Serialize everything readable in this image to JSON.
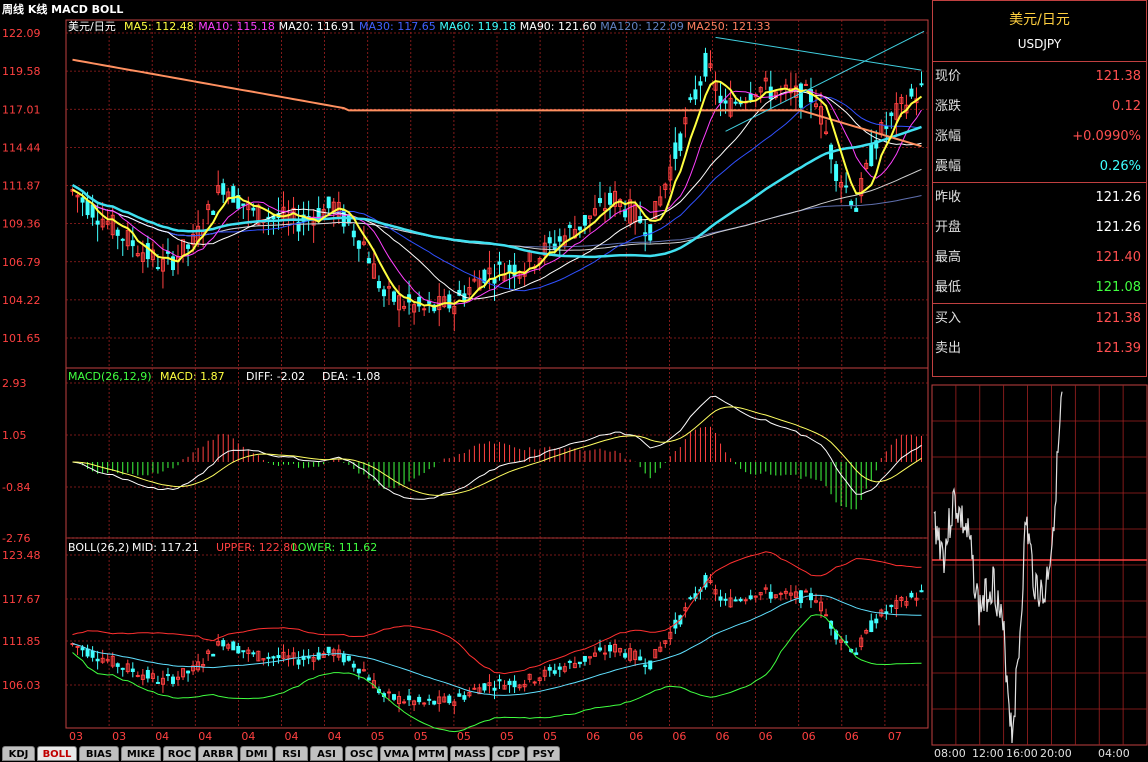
{
  "title": "周线 K线 MACD BOLL",
  "main_legend": {
    "symbol": "美元/日元",
    "items": [
      {
        "label": "MA5: 112.48",
        "color": "#ffff40"
      },
      {
        "label": "MA10: 115.18",
        "color": "#ff40ff"
      },
      {
        "label": "MA20: 116.91",
        "color": "#ffffff"
      },
      {
        "label": "MA30: 117.65",
        "color": "#4060ff"
      },
      {
        "label": "MA60: 119.18",
        "color": "#40ffff"
      },
      {
        "label": "MA90: 121.60",
        "color": "#ffffff"
      },
      {
        "label": "MA120: 122.09",
        "color": "#6080c0"
      },
      {
        "label": "MA250: 121.33",
        "color": "#ff8060"
      }
    ]
  },
  "price_axis": [
    "122.09",
    "119.58",
    "117.01",
    "114.44",
    "111.87",
    "109.36",
    "106.79",
    "104.22",
    "101.65"
  ],
  "macd_legend": {
    "name": "MACD(26,12,9)",
    "macd": "MACD: 1.87",
    "diff": "DIFF: -2.02",
    "dea": "DEA: -1.08"
  },
  "macd_axis": [
    "2.93",
    "1.05",
    "-0.84",
    "-2.76"
  ],
  "boll_legend": {
    "name": "BOLL(26,2)",
    "mid": "MID: 117.21",
    "upper": "UPPER: 122.80",
    "lower": "LOWER: 111.62"
  },
  "boll_axis": [
    "123.48",
    "117.67",
    "111.85",
    "106.03"
  ],
  "x_labels": [
    "03",
    "03",
    "04",
    "04",
    "04",
    "04",
    "04",
    "05",
    "05",
    "05",
    "05",
    "05",
    "06",
    "06",
    "06",
    "06",
    "06",
    "06",
    "06",
    "07"
  ],
  "quote": {
    "name": "美元/日元",
    "code": "USDJPY",
    "rows": [
      {
        "label": "现价",
        "value": "121.38",
        "color": "#ff5050"
      },
      {
        "label": "涨跌",
        "value": "0.12",
        "color": "#ff5050"
      },
      {
        "label": "涨幅",
        "value": "+0.0990%",
        "color": "#ff5050"
      },
      {
        "label": "震幅",
        "value": "0.26%",
        "color": "#40ffff"
      },
      {
        "label": "昨收",
        "value": "121.26",
        "color": "#ffffff"
      },
      {
        "label": "开盘",
        "value": "121.26",
        "color": "#ffffff"
      },
      {
        "label": "最高",
        "value": "121.40",
        "color": "#ff5050"
      },
      {
        "label": "最低",
        "value": "121.08",
        "color": "#40ff40"
      },
      {
        "label": "买入",
        "value": "121.38",
        "color": "#ff5050"
      },
      {
        "label": "卖出",
        "value": "121.39",
        "color": "#ff5050"
      }
    ]
  },
  "mini_axis": [
    "08:00",
    "12:00",
    "16:00",
    "20:00",
    "04:00"
  ],
  "tabs": [
    "KDJ",
    "BOLL",
    "BIAS",
    "MIKE",
    "ROC",
    "ARBR",
    "DMI",
    "RSI",
    "ASI",
    "OSC",
    "VMA",
    "MTM",
    "MASS",
    "CDP",
    "PSY"
  ],
  "active_tab": "BOLL",
  "colors": {
    "grid": "#a02020",
    "up": "#ff4040",
    "down": "#40ffff",
    "ma5": "#ffff40",
    "ma60": "#40e0f0",
    "ma250": "#ff9060"
  }
}
